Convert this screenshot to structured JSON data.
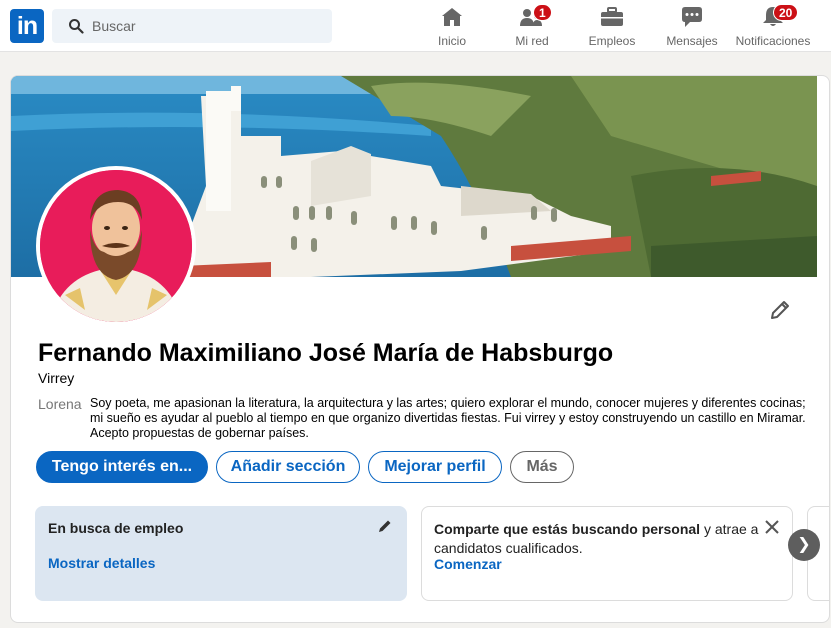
{
  "nav": {
    "logo_text": "in",
    "search_placeholder": "Buscar",
    "items": [
      {
        "label": "Inicio",
        "icon": "home-icon",
        "badge": ""
      },
      {
        "label": "Mi red",
        "icon": "network-icon",
        "badge": "1"
      },
      {
        "label": "Empleos",
        "icon": "briefcase-icon",
        "badge": ""
      },
      {
        "label": "Mensajes",
        "icon": "messages-icon",
        "badge": ""
      },
      {
        "label": "Notificaciones",
        "icon": "bell-icon",
        "badge": "20"
      }
    ]
  },
  "profile": {
    "name": "Fernando Maximiliano José María de Habsburgo",
    "headline": "Virrey",
    "about_label": "Lorena",
    "about": "Soy poeta, me apasionan la literatura, la arquitectura y las artes; quiero explorar el mundo, conocer mujeres y diferentes cocinas; mi sueño es ayudar al pueblo al tiempo en que organizo divertidas fiestas. Fui virrey y estoy construyendo un castillo en Miramar. Acepto propuestas de gobernar países."
  },
  "actions": {
    "open_to": "Tengo interés en...",
    "add_section": "Añadir sección",
    "improve": "Mejorar perfil",
    "more": "Más"
  },
  "open_to_work": {
    "title": "En busca de empleo",
    "link": "Mostrar detalles"
  },
  "hiring": {
    "bold_text": "Comparte que estás buscando personal",
    "text": " y atrae a candidatos cualificados.",
    "link": "Comenzar"
  },
  "colors": {
    "brand": "#0a66c2",
    "badge": "#cc1016",
    "avatar_bg": "#e81c5a"
  }
}
